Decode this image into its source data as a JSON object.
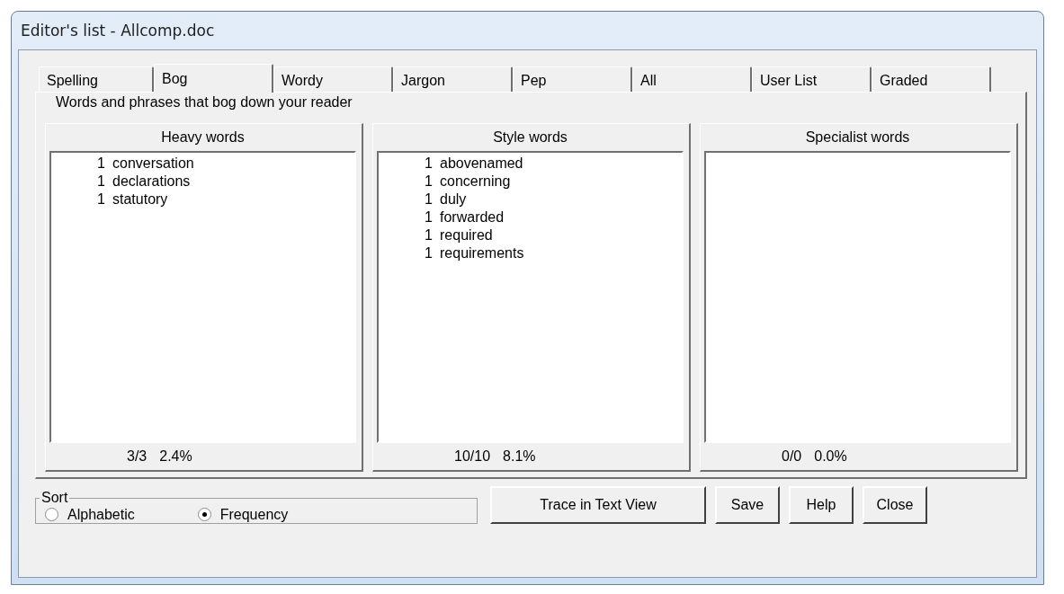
{
  "window": {
    "title": "Editor's list - Allcomp.doc"
  },
  "tabs": [
    {
      "label": "Spelling",
      "selected": false
    },
    {
      "label": "Bog",
      "selected": true
    },
    {
      "label": "Wordy",
      "selected": false
    },
    {
      "label": "Jargon",
      "selected": false
    },
    {
      "label": "Pep",
      "selected": false
    },
    {
      "label": "All",
      "selected": false
    },
    {
      "label": "User List",
      "selected": false
    },
    {
      "label": "Graded",
      "selected": false
    }
  ],
  "description": "Words and phrases that bog down your reader",
  "lists": [
    {
      "title": "Heavy words",
      "items": [
        {
          "count": "1",
          "word": "conversation"
        },
        {
          "count": "1",
          "word": "declarations"
        },
        {
          "count": "1",
          "word": "statutory"
        }
      ],
      "summary": [
        "3/3",
        "2.4%"
      ]
    },
    {
      "title": "Style words",
      "items": [
        {
          "count": "1",
          "word": "abovenamed"
        },
        {
          "count": "1",
          "word": "concerning"
        },
        {
          "count": "1",
          "word": "duly"
        },
        {
          "count": "1",
          "word": "forwarded"
        },
        {
          "count": "1",
          "word": "required"
        },
        {
          "count": "1",
          "word": "requirements"
        }
      ],
      "summary": [
        "10/10",
        "8.1%"
      ]
    },
    {
      "title": "Specialist words",
      "summary": [
        "0/0",
        "0.0%"
      ]
    }
  ],
  "sort": {
    "label": "Sort",
    "options": [
      {
        "label": "Alphabetic",
        "selected": false
      },
      {
        "label": "Frequency",
        "selected": true
      }
    ]
  },
  "buttons": [
    "Trace in Text View",
    "Save",
    "Help",
    "Close"
  ]
}
